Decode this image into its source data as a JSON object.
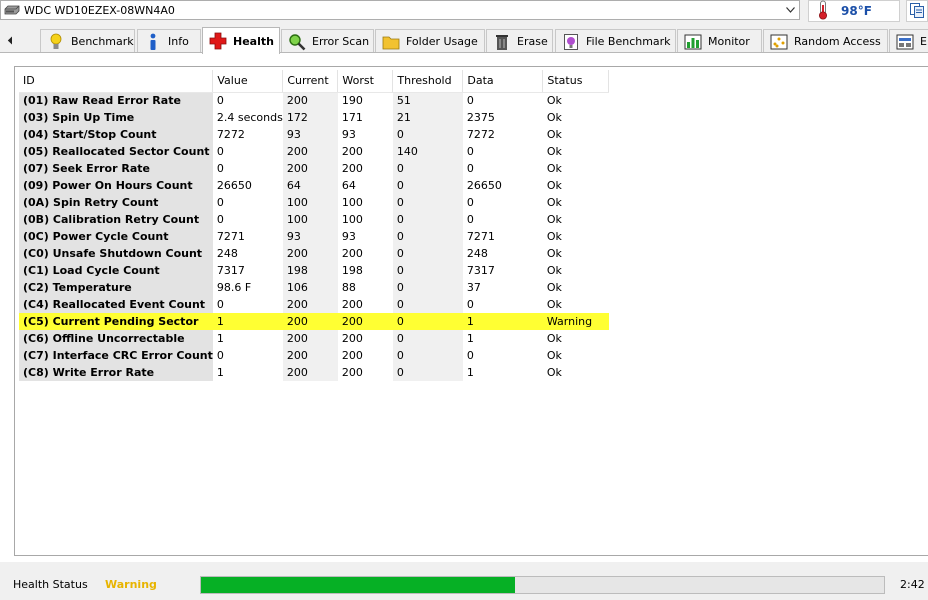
{
  "drive": {
    "name": "WDC WD10EZEX-08WN4A0"
  },
  "temperature": {
    "value": "98°F"
  },
  "tabs": [
    {
      "label": "Benchmark",
      "icon": "lightbulb-icon"
    },
    {
      "label": "Info",
      "icon": "info-icon"
    },
    {
      "label": "Health",
      "icon": "red-cross-icon",
      "active": true
    },
    {
      "label": "Error Scan",
      "icon": "magnifier-icon"
    },
    {
      "label": "Folder Usage",
      "icon": "folder-icon"
    },
    {
      "label": "Erase",
      "icon": "trash-icon"
    },
    {
      "label": "File Benchmark",
      "icon": "file-benchmark-icon"
    },
    {
      "label": "Monitor",
      "icon": "monitor-chart-icon"
    },
    {
      "label": "Random Access",
      "icon": "random-access-icon"
    },
    {
      "label": "E",
      "icon": "extra-tests-icon"
    }
  ],
  "table": {
    "columns": [
      "ID",
      "Value",
      "Current",
      "Worst",
      "Threshold",
      "Data",
      "Status"
    ],
    "rows": [
      {
        "id": "(01) Raw Read Error Rate",
        "value": "0",
        "current": "200",
        "worst": "190",
        "threshold": "51",
        "data": "0",
        "status": "Ok"
      },
      {
        "id": "(03) Spin Up Time",
        "value": "2.4 seconds",
        "current": "172",
        "worst": "171",
        "threshold": "21",
        "data": "2375",
        "status": "Ok"
      },
      {
        "id": "(04) Start/Stop Count",
        "value": "7272",
        "current": "93",
        "worst": "93",
        "threshold": "0",
        "data": "7272",
        "status": "Ok"
      },
      {
        "id": "(05) Reallocated Sector Count",
        "value": "0",
        "current": "200",
        "worst": "200",
        "threshold": "140",
        "data": "0",
        "status": "Ok"
      },
      {
        "id": "(07) Seek Error Rate",
        "value": "0",
        "current": "200",
        "worst": "200",
        "threshold": "0",
        "data": "0",
        "status": "Ok"
      },
      {
        "id": "(09) Power On Hours Count",
        "value": "26650",
        "current": "64",
        "worst": "64",
        "threshold": "0",
        "data": "26650",
        "status": "Ok"
      },
      {
        "id": "(0A) Spin Retry Count",
        "value": "0",
        "current": "100",
        "worst": "100",
        "threshold": "0",
        "data": "0",
        "status": "Ok"
      },
      {
        "id": "(0B) Calibration Retry Count",
        "value": "0",
        "current": "100",
        "worst": "100",
        "threshold": "0",
        "data": "0",
        "status": "Ok"
      },
      {
        "id": "(0C) Power Cycle Count",
        "value": "7271",
        "current": "93",
        "worst": "93",
        "threshold": "0",
        "data": "7271",
        "status": "Ok"
      },
      {
        "id": "(C0) Unsafe Shutdown Count",
        "value": "248",
        "current": "200",
        "worst": "200",
        "threshold": "0",
        "data": "248",
        "status": "Ok"
      },
      {
        "id": "(C1) Load Cycle Count",
        "value": "7317",
        "current": "198",
        "worst": "198",
        "threshold": "0",
        "data": "7317",
        "status": "Ok"
      },
      {
        "id": "(C2) Temperature",
        "value": "98.6 F",
        "current": "106",
        "worst": "88",
        "threshold": "0",
        "data": "37",
        "status": "Ok"
      },
      {
        "id": "(C4) Reallocated Event Count",
        "value": "0",
        "current": "200",
        "worst": "200",
        "threshold": "0",
        "data": "0",
        "status": "Ok"
      },
      {
        "id": "(C5) Current Pending Sector",
        "value": "1",
        "current": "200",
        "worst": "200",
        "threshold": "0",
        "data": "1",
        "status": "Warning",
        "highlight": true
      },
      {
        "id": "(C6) Offline Uncorrectable",
        "value": "1",
        "current": "200",
        "worst": "200",
        "threshold": "0",
        "data": "1",
        "status": "Ok"
      },
      {
        "id": "(C7) Interface CRC Error Count",
        "value": "0",
        "current": "200",
        "worst": "200",
        "threshold": "0",
        "data": "0",
        "status": "Ok"
      },
      {
        "id": "(C8) Write Error Rate",
        "value": "1",
        "current": "200",
        "worst": "200",
        "threshold": "0",
        "data": "1",
        "status": "Ok"
      }
    ]
  },
  "status_bar": {
    "label": "Health Status",
    "value": "Warning",
    "progress_percent": 46,
    "time": "2:42"
  },
  "colors": {
    "warning_text": "#e8b400",
    "warning_row": "#ffff33",
    "progress_fill": "#06b025",
    "temperature_text": "#1b4fa8"
  }
}
